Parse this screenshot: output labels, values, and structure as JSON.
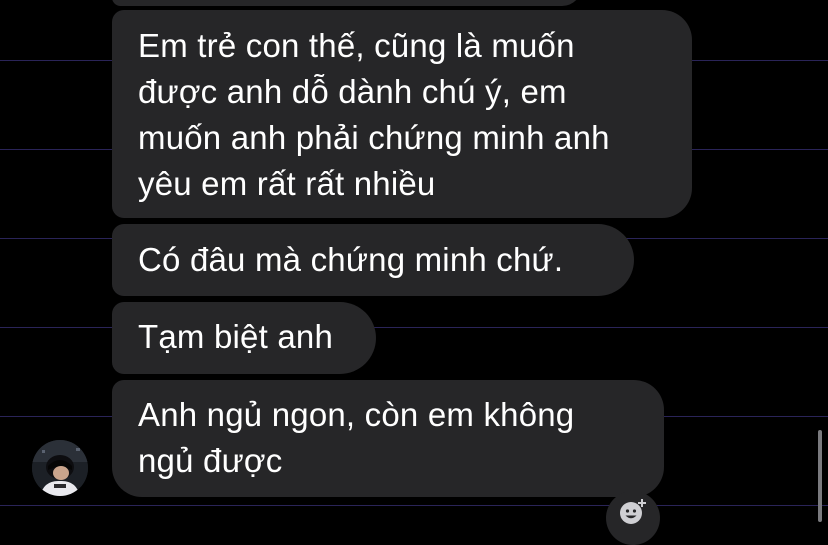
{
  "conversation": {
    "messages": [
      {
        "sender": "other",
        "text": "Em trẻ con thế, cũng là muốn\nđược anh dỗ dành chú ý, em\nmuốn anh phải chứng minh anh\nyêu em rất rất nhiều"
      },
      {
        "sender": "other",
        "text": "Có đâu mà chứng minh chứ."
      },
      {
        "sender": "other",
        "text": "Tạm biệt anh"
      },
      {
        "sender": "other",
        "text": "Anh ngủ ngon, còn em không\nngủ được"
      }
    ]
  },
  "icons": {
    "avatar": "contact-avatar",
    "reaction": "add-reaction-smiley-icon"
  },
  "colors": {
    "background": "#000000",
    "bubble": "#262628",
    "text": "#ffffff",
    "divider": "#2a2458"
  }
}
